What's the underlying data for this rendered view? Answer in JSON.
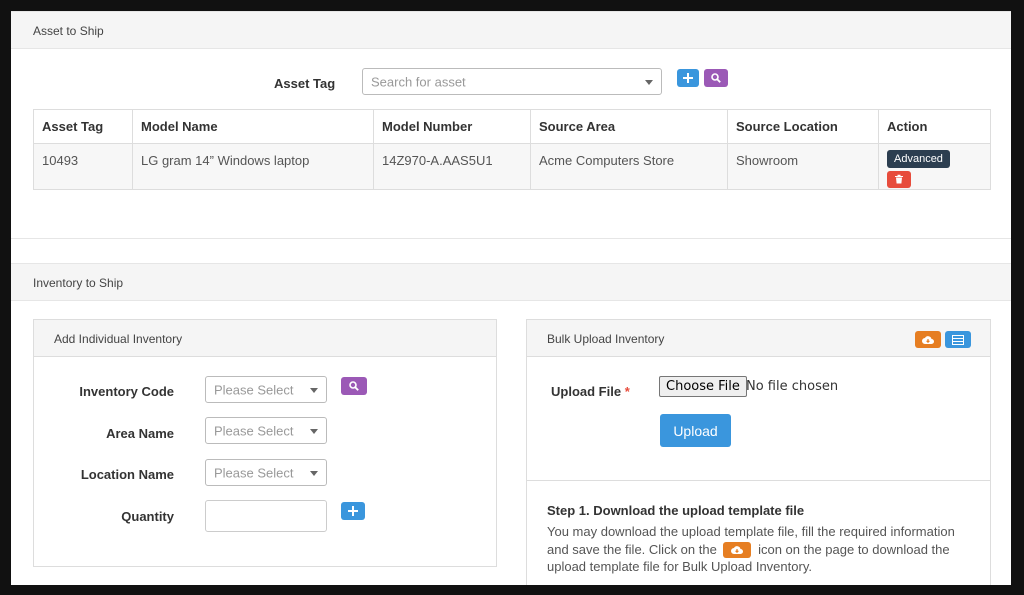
{
  "asset_section": {
    "title": "Asset to Ship",
    "asset_tag_label": "Asset Tag",
    "search_placeholder": "Search for asset",
    "table": {
      "headers": [
        "Asset Tag",
        "Model Name",
        "Model Number",
        "Source Area",
        "Source Location",
        "Action"
      ],
      "rows": [
        {
          "asset_tag": "10493",
          "model_name": "LG gram 14” Windows laptop",
          "model_number": "14Z970-A.AAS5U1",
          "source_area": "Acme Computers Store",
          "source_location": "Showroom",
          "advanced_label": "Advanced"
        }
      ]
    }
  },
  "inventory_section": {
    "title": "Inventory to Ship",
    "individual": {
      "title": "Add Individual Inventory",
      "inventory_code_label": "Inventory Code",
      "area_name_label": "Area Name",
      "location_name_label": "Location Name",
      "quantity_label": "Quantity",
      "select_placeholder": "Please Select"
    },
    "bulk": {
      "title": "Bulk Upload Inventory",
      "upload_file_label": "Upload File",
      "required_mark": "*",
      "choose_file_label": "Choose File",
      "no_file_text": "No file chosen",
      "upload_label": "Upload",
      "step1_title": "Step 1. Download the upload template file",
      "step1_text_a": "You may download the upload template file, fill the required information and save the file. Click on the",
      "step1_text_b": "icon on the page to download the upload template file for Bulk Upload Inventory."
    }
  },
  "colors": {
    "blue": "#3a96dd",
    "purple": "#9b59b6",
    "orange": "#e67e22",
    "red": "#e74c3c",
    "dark": "#2c3e50"
  },
  "icons": [
    "plus-icon",
    "search-icon",
    "trash-icon",
    "cloud-download-icon",
    "list-icon",
    "chevron-down-icon"
  ]
}
